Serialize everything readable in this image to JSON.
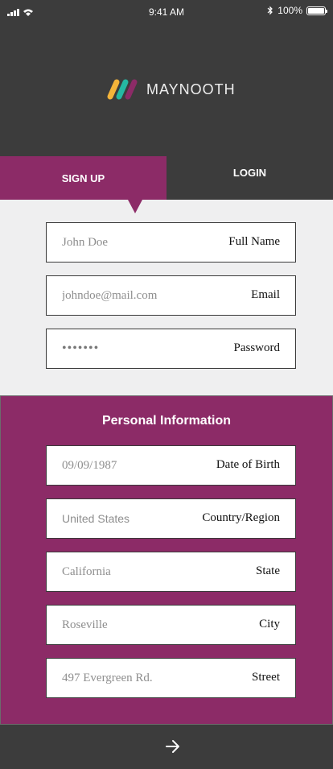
{
  "status_bar": {
    "time": "9:41 AM",
    "battery": "100%"
  },
  "brand": {
    "name": "MAYNOOTH",
    "colors": [
      "#f4b43a",
      "#25b8a3",
      "#8c2b67"
    ]
  },
  "tabs": {
    "signup": "SIGN UP",
    "login": "LOGIN",
    "active": "signup"
  },
  "account": {
    "full_name": {
      "label": "Full Name",
      "placeholder": "John Doe"
    },
    "email": {
      "label": "Email",
      "placeholder": "johndoe@mail.com"
    },
    "password": {
      "label": "Password",
      "value": "•••••••"
    }
  },
  "personal": {
    "title": "Personal Information",
    "dob": {
      "label": "Date of Birth",
      "placeholder": "09/09/1987"
    },
    "country": {
      "label": "Country/Region",
      "placeholder": "United States"
    },
    "state": {
      "label": "State",
      "placeholder": "California"
    },
    "city": {
      "label": "City",
      "placeholder": "Roseville"
    },
    "street": {
      "label": "Street",
      "placeholder": "497 Evergreen Rd."
    }
  },
  "colors": {
    "accent": "#8c2b67",
    "dark": "#3c3c3c",
    "light": "#efeff0"
  },
  "icons": {
    "next": "arrow-right-icon"
  }
}
